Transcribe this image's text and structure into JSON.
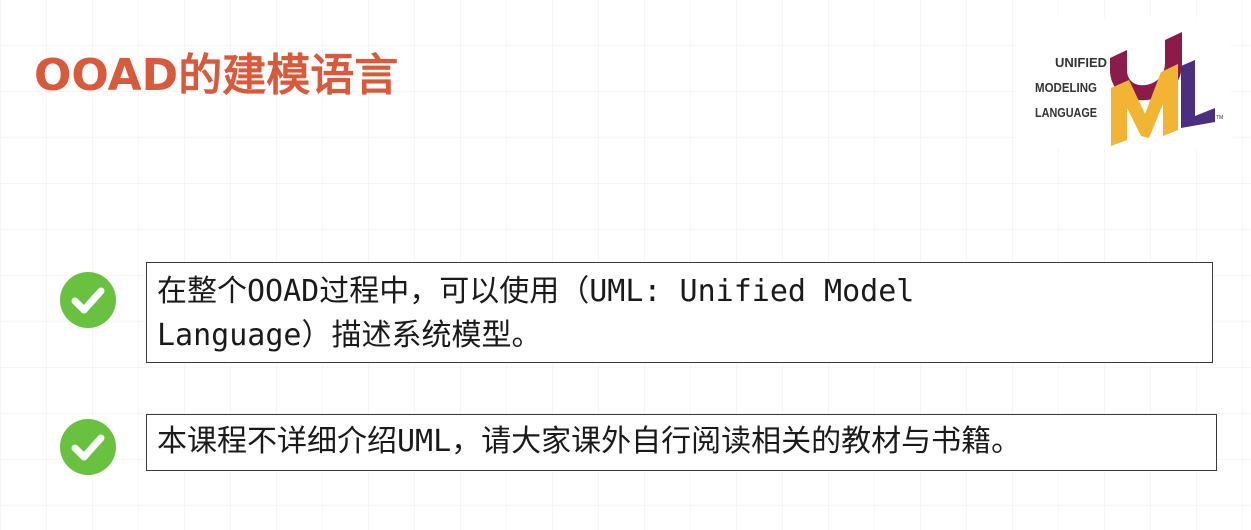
{
  "slide": {
    "title": "OOAD的建模语言",
    "logo": {
      "line1": "UNIFIED",
      "line2": "MODELING",
      "line3": "LANGUAGE",
      "tm": "TM",
      "colors": {
        "u": "#8b1c4a",
        "m": "#f2b533",
        "l": "#4b2e7f"
      }
    },
    "bullets": [
      {
        "icon": "check-icon",
        "line1": "在整个OOAD过程中，可以使用（UML: Unified Model",
        "line2": "Language）描述系统模型。"
      },
      {
        "icon": "check-icon",
        "text": "本课程不详细介绍UML，请大家课外自行阅读相关的教材与书籍。"
      }
    ],
    "colors": {
      "title": "#d9593b",
      "check": "#68c23f"
    }
  }
}
